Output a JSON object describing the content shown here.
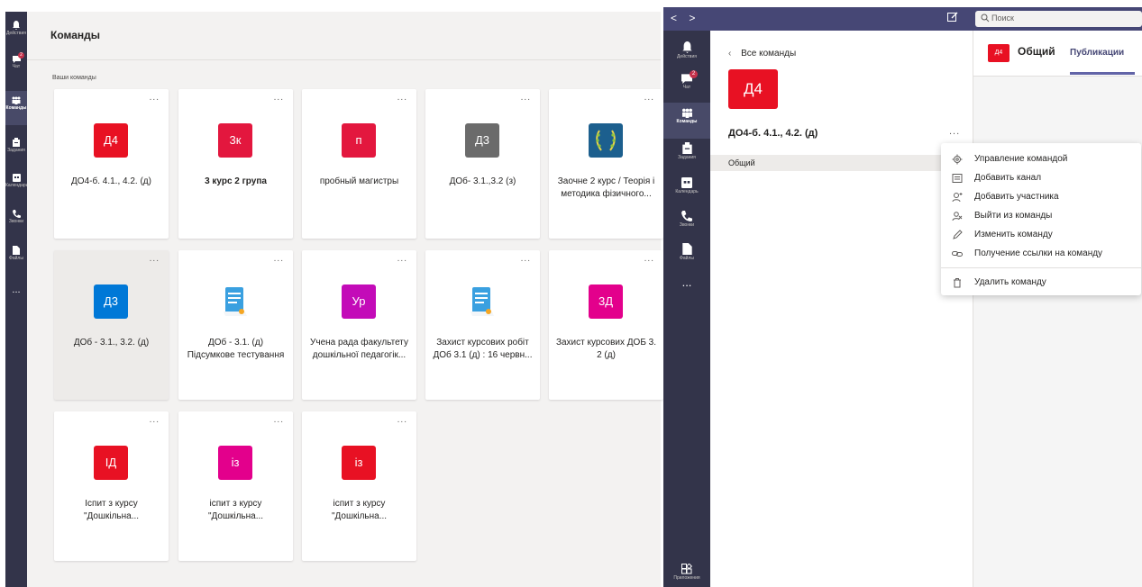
{
  "left_app": {
    "rail": [
      {
        "label": "Действия",
        "icon": "bell-icon"
      },
      {
        "label": "Чат",
        "icon": "chat-icon",
        "badge": "2"
      },
      {
        "label": "Команды",
        "icon": "teams-icon",
        "active": true
      },
      {
        "label": "Задания",
        "icon": "assignments-icon"
      },
      {
        "label": "Календарь",
        "icon": "calendar-icon"
      },
      {
        "label": "Звонки",
        "icon": "phone-icon"
      },
      {
        "label": "Файлы",
        "icon": "files-icon"
      }
    ],
    "rail_more": "...",
    "page_title": "Команды",
    "section_label": "Ваши команды",
    "more_label": "...",
    "teams": [
      {
        "initials": "Д4",
        "name": "ДО4-б. 4.1., 4.2. (д)",
        "color": "#e81123"
      },
      {
        "initials": "3к",
        "name": "3 курс 2 група",
        "color": "#e3173e",
        "bold": true
      },
      {
        "initials": "п",
        "name": "пробный магистры",
        "color": "#e3173e"
      },
      {
        "initials": "Д3",
        "name": "ДОб- 3.1.,3.2 (з)",
        "color": "#6b6b6b"
      },
      {
        "initials": "",
        "name": "Заочне 2 курс / Теорія і методика фізичного...",
        "image": "laurel-emblem"
      },
      {
        "initials": "Д3",
        "name": "ДОб - 3.1., 3.2. (д)",
        "color": "#0078d7",
        "selected": true
      },
      {
        "initials": "",
        "name": "ДОб - 3.1. (д) Підсумкове тестування",
        "image": "scroll-document"
      },
      {
        "initials": "Ур",
        "name": "Учена рада факультету дошкільної педагогік...",
        "color": "#c30bb8"
      },
      {
        "initials": "",
        "name": "Захист курсових робіт ДОб 3.1 (д) : 16 червн...",
        "image": "scroll-document"
      },
      {
        "initials": "3Д",
        "name": "Захист курсових ДОБ 3. 2 (д)",
        "color": "#e3008c"
      },
      {
        "initials": "ІД",
        "name": "Іспит з курсу \"Дошкільна...",
        "color": "#e81123"
      },
      {
        "initials": "із",
        "name": "іспит з курсу \"Дошкільна...",
        "color": "#e3008c"
      },
      {
        "initials": "із",
        "name": "іспит з курсу \"Дошкільна...",
        "color": "#e81123"
      }
    ]
  },
  "right_app": {
    "nav_back": "<",
    "nav_forward": ">",
    "search_placeholder": "Поиск",
    "rail": [
      {
        "label": "Действия",
        "icon": "bell-icon"
      },
      {
        "label": "Чат",
        "icon": "chat-icon",
        "badge": "2"
      },
      {
        "label": "Команды",
        "icon": "teams-icon",
        "active": true
      },
      {
        "label": "Задания",
        "icon": "assignments-icon"
      },
      {
        "label": "Календарь",
        "icon": "calendar-icon"
      },
      {
        "label": "Звонки",
        "icon": "phone-icon"
      },
      {
        "label": "Файлы",
        "icon": "files-icon"
      }
    ],
    "rail_more": "...",
    "rail_apps": "Приложения",
    "back_link": "Все команды",
    "team_initials": "Д4",
    "team_name": "ДО4-б. 4.1., 4.2. (д)",
    "team_more": "...",
    "channel": "Общий",
    "channel_header": {
      "avatar": "Д4",
      "name": "Общий",
      "tab": "Публикации"
    },
    "menu": [
      {
        "label": "Управление командой",
        "icon": "gear-icon"
      },
      {
        "label": "Добавить канал",
        "icon": "channel-icon"
      },
      {
        "label": "Добавить участника",
        "icon": "add-person-icon"
      },
      {
        "label": "Выйти из команды",
        "icon": "leave-icon"
      },
      {
        "label": "Изменить команду",
        "icon": "pencil-icon"
      },
      {
        "label": "Получение ссылки на команду",
        "icon": "link-icon"
      },
      {
        "label": "Удалить команду",
        "icon": "trash-icon"
      }
    ]
  },
  "colors": {
    "rail": "#33344a",
    "topbar": "#464775",
    "accent": "#6264a7",
    "badge": "#c4314b"
  }
}
